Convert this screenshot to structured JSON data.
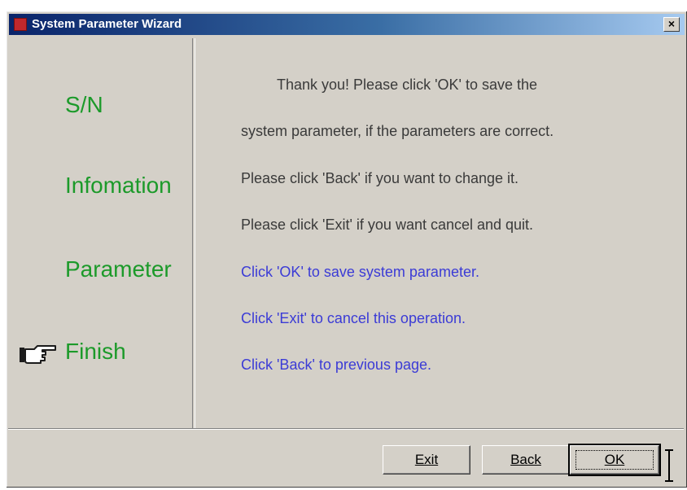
{
  "window": {
    "title": "System Parameter Wizard",
    "close_label": "×"
  },
  "steps": [
    {
      "label": "S/N",
      "current": false
    },
    {
      "label": "Infomation",
      "current": false
    },
    {
      "label": "Parameter",
      "current": false
    },
    {
      "label": "Finish",
      "current": true
    }
  ],
  "content": {
    "lines": [
      "Thank you! Please click 'OK' to save the",
      "system parameter, if the parameters are correct.",
      "Please click 'Back' if you want to change it.",
      "Please click 'Exit' if you want cancel and quit."
    ],
    "hints": [
      "Click 'OK' to save system parameter.",
      "Click 'Exit' to cancel this operation.",
      "Click 'Back' to previous page."
    ]
  },
  "buttons": {
    "exit": "Exit",
    "back": "Back",
    "ok": "OK"
  },
  "colors": {
    "step_text": "#1c9a2a",
    "hint_text": "#3b3bd6",
    "body_text": "#3a3a3a",
    "titlebar_start": "#0a246a",
    "titlebar_end": "#a6caf0"
  },
  "icons": {
    "current_step_pointer": "pointing-hand-icon",
    "window_icon": "app-icon"
  }
}
